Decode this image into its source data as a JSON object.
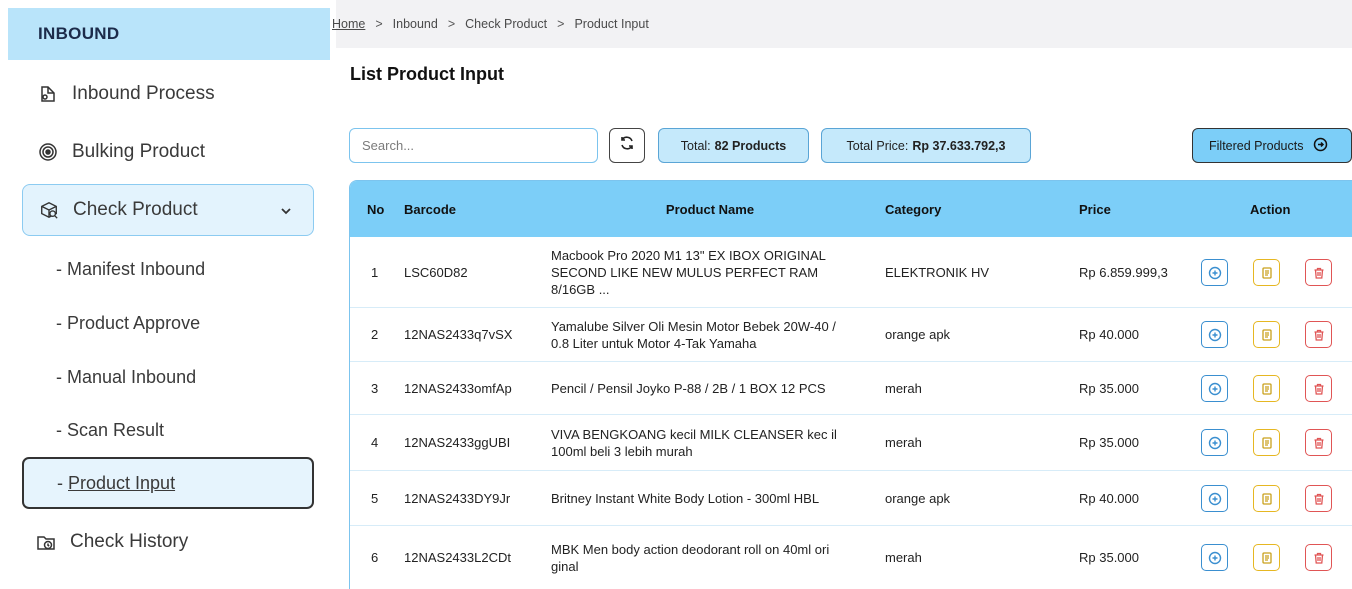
{
  "sidebar": {
    "header": "INBOUND",
    "items": [
      {
        "label": "Inbound Process",
        "icon": "inbound-box-icon"
      },
      {
        "label": "Bulking Product",
        "icon": "target-icon"
      },
      {
        "label": "Check Product",
        "icon": "package-search-icon"
      },
      {
        "label": "Check History",
        "icon": "folder-clock-icon"
      }
    ],
    "subitems": [
      "- Manifest Inbound",
      "- Product Approve",
      "- Manual Inbound",
      "- Scan Result"
    ],
    "current_prefix": "- ",
    "current_label": "Product Input"
  },
  "breadcrumb": {
    "home": "Home",
    "separator": ">",
    "items": [
      "Inbound",
      "Check Product",
      "Product Input"
    ]
  },
  "page": {
    "title": "List Product Input"
  },
  "toolbar": {
    "search_placeholder": "Search...",
    "total_label": "Total:",
    "total_value": "82 Products",
    "price_label": "Total Price:",
    "price_value": "Rp 37.633.792,3",
    "filtered_label": "Filtered Products"
  },
  "table": {
    "headers": {
      "no": "No",
      "barcode": "Barcode",
      "name": "Product Name",
      "category": "Category",
      "price": "Price",
      "action": "Action"
    },
    "rows": [
      {
        "no": "1",
        "barcode": "LSC60D82",
        "name": "Macbook Pro 2020 M1 13\" EX IBOX ORIGINAL SECOND LIKE NEW MULUS PERFECT RAM 8/16GB ...",
        "category": "ELEKTRONIK HV",
        "price": "Rp 6.859.999,3"
      },
      {
        "no": "2",
        "barcode": "12NAS2433q7vSX",
        "name": "Yamalube Silver Oli Mesin Motor Bebek 20W-40 / 0.8 Liter untuk Motor 4-Tak Yamaha",
        "category": "orange apk",
        "price": "Rp 40.000"
      },
      {
        "no": "3",
        "barcode": "12NAS2433omfAp",
        "name": "Pencil / Pensil Joyko P-88 / 2B / 1 BOX 12 PCS",
        "category": "merah",
        "price": "Rp 35.000"
      },
      {
        "no": "4",
        "barcode": "12NAS2433ggUBI",
        "name": "VIVA BENGKOANG kecil MILK CLEANSER kec il 100ml beli 3 lebih murah",
        "category": "merah",
        "price": "Rp 35.000"
      },
      {
        "no": "5",
        "barcode": "12NAS2433DY9Jr",
        "name": "Britney Instant White Body Lotion - 300ml HBL",
        "category": "orange apk",
        "price": "Rp 40.000"
      },
      {
        "no": "6",
        "barcode": "12NAS2433L2CDt",
        "name": "MBK Men body action deodorant roll on 40ml ori ginal",
        "category": "merah",
        "price": "Rp 35.000"
      }
    ]
  },
  "colors": {
    "accent": "#7ccef8",
    "header_bg": "#b9e4fa",
    "add": "#3a8fd0",
    "detail": "#e6b722",
    "delete": "#e05555"
  }
}
